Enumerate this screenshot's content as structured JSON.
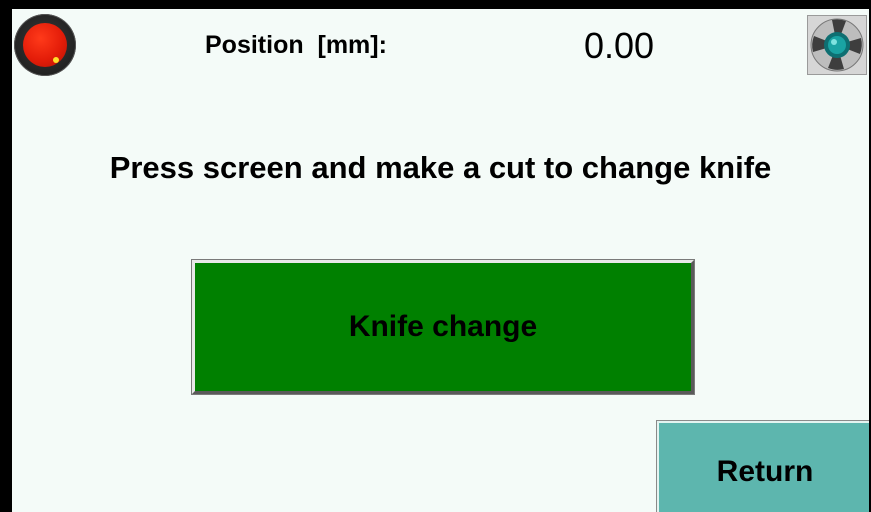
{
  "header": {
    "status_lamp_icon": "red-indicator-lamp-icon",
    "status_lamp_color": "#e41d09",
    "position_label": "Position  [mm]:",
    "position_value": "0.00",
    "settings_icon": "fan-settings-icon"
  },
  "main": {
    "instruction": "Press screen and make a cut to change knife",
    "knife_change_label": "Knife change",
    "knife_change_color": "#008000"
  },
  "footer": {
    "return_label": "Return",
    "return_color": "#5db6ae"
  }
}
